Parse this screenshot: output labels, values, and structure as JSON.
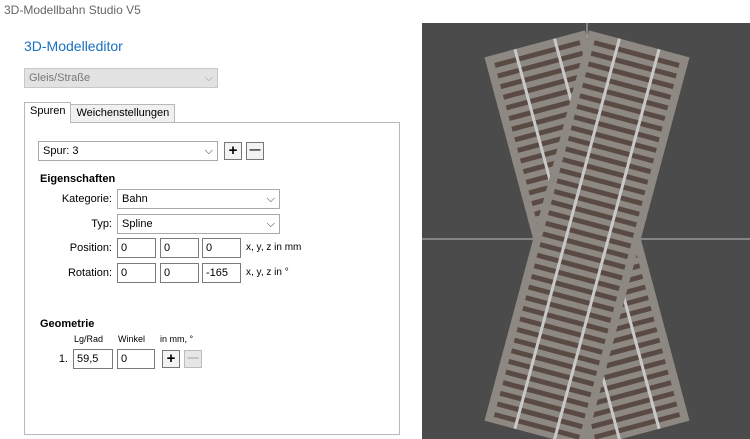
{
  "window": {
    "title": "3D-Modellbahn Studio V5"
  },
  "editor": {
    "title": "3D-Modelleditor",
    "type_select": "Gleis/Straße",
    "tabs": [
      {
        "label": "Spuren",
        "active": true
      },
      {
        "label": "Weichenstellungen",
        "active": false
      }
    ]
  },
  "spur": {
    "select": "Spur: 3",
    "add": "+",
    "remove": "—"
  },
  "eigenschaften": {
    "heading": "Eigenschaften",
    "kategorie_label": "Kategorie:",
    "kategorie_value": "Bahn",
    "typ_label": "Typ:",
    "typ_value": "Spline",
    "position_label": "Position:",
    "position": [
      "0",
      "0",
      "0"
    ],
    "position_hint": "x, y, z in mm",
    "rotation_label": "Rotation:",
    "rotation": [
      "0",
      "0",
      "-165"
    ],
    "rotation_hint": "x, y, z in °"
  },
  "geometrie": {
    "heading": "Geometrie",
    "col1": "Lg/Rad",
    "col2": "Winkel",
    "col3": "in mm, °",
    "row_index": "1.",
    "length": "59,5",
    "angle": "0",
    "add": "+",
    "remove": "—"
  },
  "viewport": {
    "background": "#4b4b4b",
    "ballast": "#8e8883",
    "sleeper": "#5a4a44",
    "rail": "#c9c9c9",
    "crosshair": "#bdbdbd",
    "track_angles_deg": [
      -15,
      15
    ]
  },
  "icons": {
    "chevron": "⌵"
  }
}
